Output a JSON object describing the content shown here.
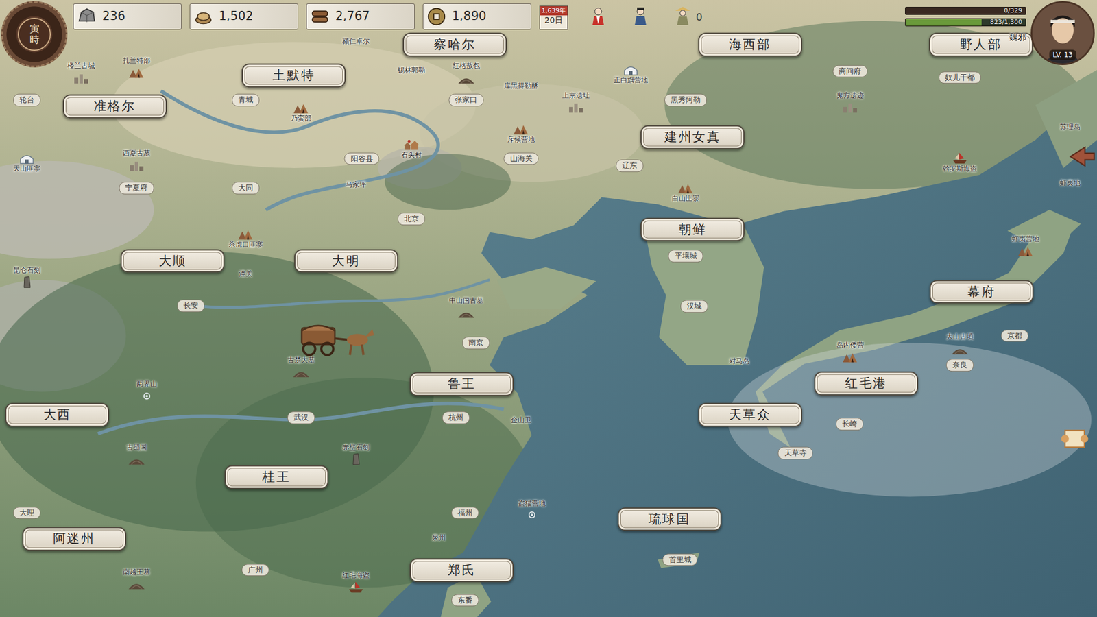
{
  "hud": {
    "clock": "寅時",
    "resources": [
      {
        "name": "stone",
        "value": "236"
      },
      {
        "name": "grain",
        "value": "1,502"
      },
      {
        "name": "wood",
        "value": "2,767"
      },
      {
        "name": "coin",
        "value": "1,890"
      }
    ],
    "date": {
      "year": "1,639年",
      "day": "20日"
    },
    "party_count": "0"
  },
  "player": {
    "name": "魏邪",
    "level": "LV. 13",
    "hp": {
      "reading": "0/329",
      "level": 0
    },
    "exp": {
      "reading": "823/1,300",
      "level": 0.633
    }
  },
  "factions": [
    "察哈尔",
    "海西部",
    "野人部",
    "土默特",
    "准格尔",
    "建州女真",
    "朝鲜",
    "大顺",
    "大明",
    "幕府",
    "鲁王",
    "红毛港",
    "天草众",
    "大西",
    "桂王",
    "阿迷州",
    "琉球国",
    "郑氏"
  ],
  "cities": [
    "轮台",
    "青城",
    "张家口",
    "黑秀阿勒",
    "商间府",
    "奴儿干都",
    "宁夏府",
    "大同",
    "阳谷县",
    "山海关",
    "辽东",
    "北京",
    "平壤城",
    "汉城",
    "长安",
    "南京",
    "杭州",
    "武汉",
    "大理",
    "福州",
    "广州",
    "东番",
    "长崎",
    "奈良",
    "京都",
    "首里城",
    "天草寺"
  ],
  "sites": [
    {
      "label": "楼兰古城",
      "kind": "ruins"
    },
    {
      "label": "扎兰特部",
      "kind": "camp"
    },
    {
      "label": "额仁卓尔",
      "kind": "label"
    },
    {
      "label": "锡林郭勒",
      "kind": "label"
    },
    {
      "label": "红格敖包",
      "kind": "mound"
    },
    {
      "label": "库黑得勒酥",
      "kind": "label"
    },
    {
      "label": "上京遗址",
      "kind": "ruins"
    },
    {
      "label": "正白旗营地",
      "kind": "yurt"
    },
    {
      "label": "鬼方遗迹",
      "kind": "ruins"
    },
    {
      "label": "苏理岛",
      "kind": "label"
    },
    {
      "label": "斡罗斯海盗",
      "kind": "ship"
    },
    {
      "label": "虾夷地",
      "kind": "label"
    },
    {
      "label": "虾夷营地",
      "kind": "camp"
    },
    {
      "label": "乃蛮部",
      "kind": "camp"
    },
    {
      "label": "西夏古墓",
      "kind": "ruins"
    },
    {
      "label": "天山匪寨",
      "kind": "yurt"
    },
    {
      "label": "斥候营地",
      "kind": "camp"
    },
    {
      "label": "石头村",
      "kind": "village"
    },
    {
      "label": "马家坪",
      "kind": "label"
    },
    {
      "label": "白山匪寨",
      "kind": "camp"
    },
    {
      "label": "杀虎口匪寨",
      "kind": "camp"
    },
    {
      "label": "潼关",
      "kind": "label"
    },
    {
      "label": "昆仑石刻",
      "kind": "stone"
    },
    {
      "label": "中山国古墓",
      "kind": "mound"
    },
    {
      "label": "古楚大墓",
      "kind": "mound"
    },
    {
      "label": "两界山",
      "kind": "point"
    },
    {
      "label": "古蜀国",
      "kind": "mound"
    },
    {
      "label": "赤壁石刻",
      "kind": "stone"
    },
    {
      "label": "金山卫",
      "kind": "label"
    },
    {
      "label": "岛内倭营",
      "kind": "camp"
    },
    {
      "label": "大山古墳",
      "kind": "mound"
    },
    {
      "label": "盗猫营地",
      "kind": "point"
    },
    {
      "label": "南越王墓",
      "kind": "mound"
    },
    {
      "label": "红毛海盗",
      "kind": "ship"
    },
    {
      "label": "对马岛",
      "kind": "label"
    },
    {
      "label": "泉州",
      "kind": "label"
    }
  ]
}
